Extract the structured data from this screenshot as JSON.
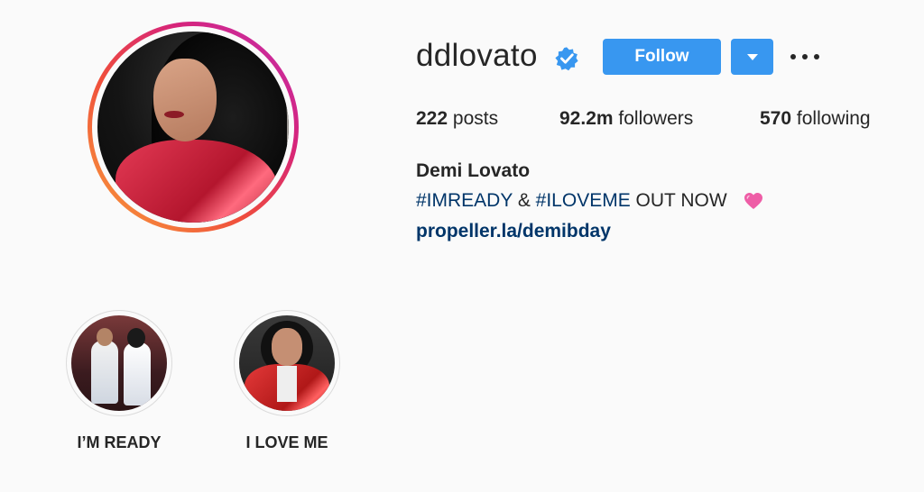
{
  "profile": {
    "username": "ddlovato",
    "verified_icon": "verified-badge-icon",
    "follow_label": "Follow",
    "dropdown_icon": "triangle-down-icon",
    "more_icon": "more-options-icon",
    "avatar_alt": "profile-photo"
  },
  "stats": {
    "posts_count": "222",
    "posts_label": "posts",
    "followers_count": "92.2m",
    "followers_label": "followers",
    "following_count": "570",
    "following_label": "following"
  },
  "bio": {
    "full_name": "Demi Lovato",
    "hashtag1": "#IMREADY",
    "amp": " & ",
    "hashtag2": "#ILOVEME",
    "rest": " OUT NOW ",
    "heart_icon": "pink-heart-icon",
    "link": "propeller.la/demibday"
  },
  "highlights": [
    {
      "label": "I’M READY"
    },
    {
      "label": "I LOVE ME"
    }
  ],
  "colors": {
    "background": "#fafafa",
    "primary_button": "#3897f0",
    "text": "#262626",
    "link": "#003569",
    "verified": "#3897f0"
  }
}
